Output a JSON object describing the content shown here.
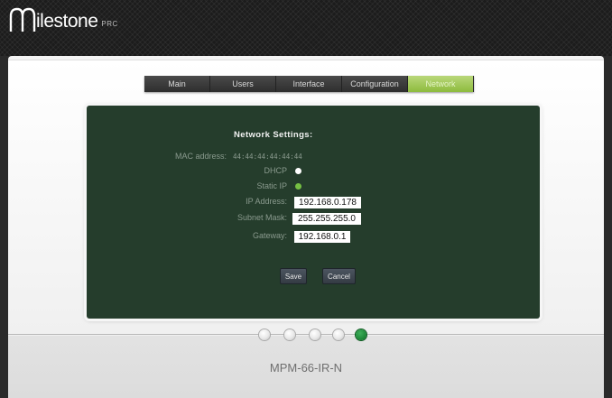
{
  "brand": {
    "name": "ilestone",
    "suffix": "PRC"
  },
  "tabs": [
    {
      "label": "Main"
    },
    {
      "label": "Users"
    },
    {
      "label": "Interface"
    },
    {
      "label": "Configuration"
    },
    {
      "label": "Network"
    }
  ],
  "active_tab": "Network",
  "network": {
    "title": "Network  Settings:",
    "mac_label": "MAC address:",
    "mac_value": "44:44:44:44:44:44",
    "dhcp_label": "DHCP",
    "static_label": "Static IP",
    "ip_label": "IP Address:",
    "ip_value": "192.168.0.178",
    "subnet_label": "Subnet Mask:",
    "subnet_value": "255.255.255.0",
    "gateway_label": "Gateway:",
    "gateway_value": "192.168.0.1"
  },
  "buttons": {
    "save": "Save",
    "cancel": "Cancel"
  },
  "pager": {
    "active_page": 5,
    "total_pages": 5
  },
  "model": "MPM-66-IR-N",
  "colors": {
    "accent_green": "#8dbb3d",
    "panel_green": "#253d2c",
    "active_dot": "#1f8a3a"
  }
}
